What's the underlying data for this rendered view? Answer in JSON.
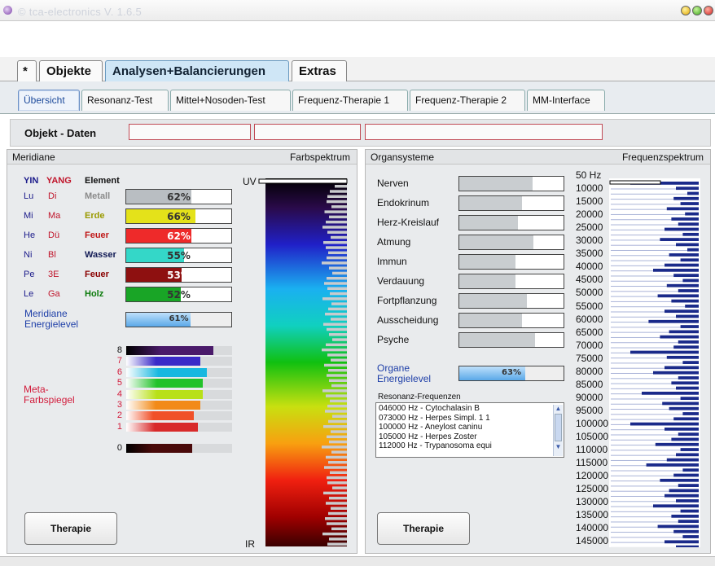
{
  "window": {
    "title": "© tca-electronics V. 1.6.5"
  },
  "main_tabs": [
    {
      "label": "*"
    },
    {
      "label": "Objekte"
    },
    {
      "label": "Analysen+Balancierungen",
      "active": true
    },
    {
      "label": "Extras"
    }
  ],
  "sub_tabs": [
    {
      "label": "Übersicht",
      "active": true
    },
    {
      "label": "Resonanz-Test"
    },
    {
      "label": "Mittel+Nosoden-Test"
    },
    {
      "label": "Frequenz-Therapie 1"
    },
    {
      "label": "Frequenz-Therapie 2"
    },
    {
      "label": "MM-Interface"
    }
  ],
  "object_data": {
    "label": "Objekt - Daten",
    "fields": [
      "",
      "",
      ""
    ]
  },
  "meridians": {
    "header": "Meridiane",
    "spectrum_header": "Farbspektrum",
    "col_yin": "YIN",
    "col_yang": "YANG",
    "col_element": "Element",
    "rows": [
      {
        "yin": "Lu",
        "yang": "Di",
        "element": "Metall",
        "element_color": "#8a8a8a",
        "value": "62%",
        "fraction": 0.62,
        "color": "#b9bec2"
      },
      {
        "yin": "Mi",
        "yang": "Ma",
        "element": "Erde",
        "element_color": "#9a9a00",
        "value": "66%",
        "fraction": 0.66,
        "color": "#e4e21a"
      },
      {
        "yin": "He",
        "yang": "Dü",
        "element": "Feuer",
        "element_color": "#c01818",
        "value": "62%",
        "fraction": 0.62,
        "color": "#ee2a2a"
      },
      {
        "yin": "Ni",
        "yang": "Bl",
        "element": "Wasser",
        "element_color": "#111a55",
        "value": "55%",
        "fraction": 0.55,
        "color": "#34d7c8"
      },
      {
        "yin": "Pe",
        "yang": "3E",
        "element": "Feuer",
        "element_color": "#8a0000",
        "value": "53%",
        "fraction": 0.53,
        "color": "#8e1010"
      },
      {
        "yin": "Le",
        "yang": "Ga",
        "element": "Holz",
        "element_color": "#0a7a0a",
        "value": "52%",
        "fraction": 0.52,
        "color": "#19a526"
      }
    ],
    "energy_label": "Meridiane Energielevel",
    "energy_value": "61%",
    "energy_fraction": 0.61,
    "meta_label": "Meta-Farbspiegel",
    "meta_rows": [
      {
        "num": "8",
        "fraction": 0.82,
        "color": "#4a1a6a"
      },
      {
        "num": "7",
        "fraction": 0.7,
        "color": "#3a2ac8"
      },
      {
        "num": "6",
        "fraction": 0.76,
        "color": "#18b8e0"
      },
      {
        "num": "5",
        "fraction": 0.72,
        "color": "#22c22a"
      },
      {
        "num": "4",
        "fraction": 0.72,
        "color": "#b8e018"
      },
      {
        "num": "3",
        "fraction": 0.7,
        "color": "#f28a18"
      },
      {
        "num": "2",
        "fraction": 0.64,
        "color": "#f05028"
      },
      {
        "num": "1",
        "fraction": 0.68,
        "color": "#d82a2a"
      },
      {
        "num": "0",
        "fraction": 0.62,
        "color": "#4a0a0a"
      }
    ],
    "spectrum_top": "UV",
    "spectrum_bottom": "IR",
    "therapy_button": "Therapie"
  },
  "organs": {
    "header": "Organsysteme",
    "spectrum_header": "Frequenzspektrum",
    "rows": [
      {
        "name": "Nerven",
        "value": "70%",
        "fraction": 0.7
      },
      {
        "name": "Endokrinum",
        "value": "60%",
        "fraction": 0.6
      },
      {
        "name": "Herz-Kreislauf",
        "value": "56%",
        "fraction": 0.56
      },
      {
        "name": "Atmung",
        "value": "71%",
        "fraction": 0.71
      },
      {
        "name": "Immun",
        "value": "54%",
        "fraction": 0.54
      },
      {
        "name": "Verdauung",
        "value": "54%",
        "fraction": 0.54
      },
      {
        "name": "Fortpflanzung",
        "value": "65%",
        "fraction": 0.65
      },
      {
        "name": "Ausscheidung",
        "value": "60%",
        "fraction": 0.6
      },
      {
        "name": "Psyche",
        "value": "73%",
        "fraction": 0.73
      }
    ],
    "energy_label": "Organe Energielevel",
    "energy_value": "63%",
    "energy_fraction": 0.63,
    "resonance_label": "Resonanz-Frequenzen",
    "resonance_items": [
      "046000 Hz - Cytochalasin B",
      "073000 Hz - Herpes Simpl. 1 1",
      "100000 Hz - Aneylost caninu",
      "105000 Hz - Herpes Zoster",
      "112000 Hz - Trypanosoma equi"
    ],
    "therapy_button": "Therapie",
    "freq_labels": [
      "50 Hz",
      "10000",
      "15000",
      "20000",
      "25000",
      "30000",
      "35000",
      "40000",
      "45000",
      "50000",
      "55000",
      "60000",
      "65000",
      "70000",
      "75000",
      "80000",
      "85000",
      "90000",
      "95000",
      "100000",
      "105000",
      "110000",
      "115000",
      "120000",
      "125000",
      "130000",
      "135000",
      "140000",
      "145000"
    ]
  }
}
